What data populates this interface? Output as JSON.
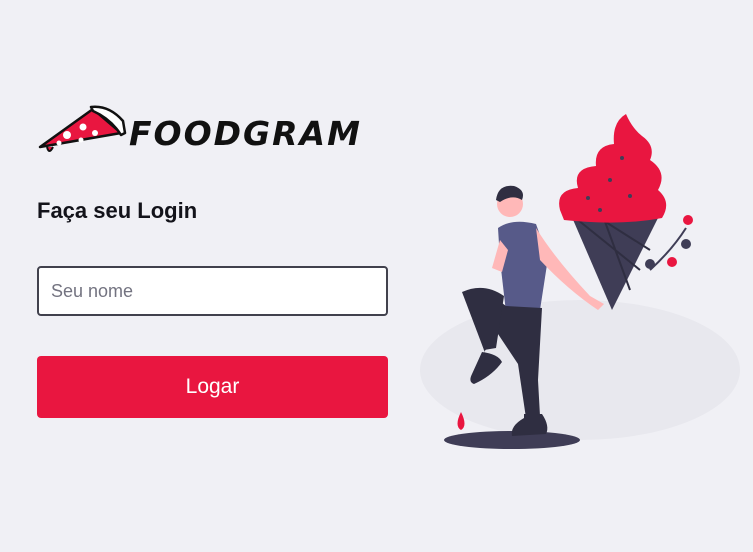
{
  "brand": {
    "name": "FOODGRAM",
    "logo_icon": "pizza-slice-icon",
    "accent_color": "#e91640"
  },
  "login": {
    "title": "Faça seu Login",
    "name_input": {
      "value": "",
      "placeholder": "Seu nome"
    },
    "submit_label": "Logar"
  },
  "illustration": "person-with-ice-cream-illustration"
}
